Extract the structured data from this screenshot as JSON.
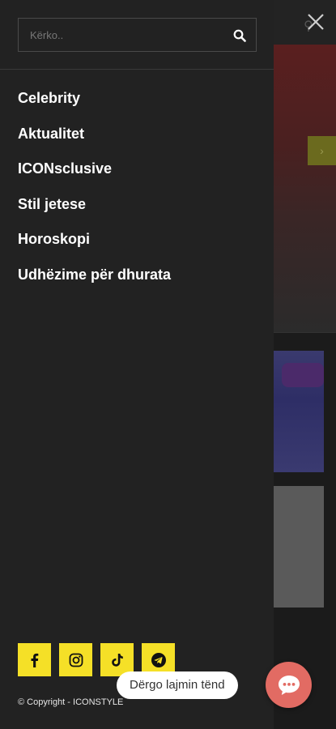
{
  "search": {
    "placeholder": "Kërko.."
  },
  "menu": {
    "items": [
      {
        "label": "Celebrity"
      },
      {
        "label": "Aktualitet"
      },
      {
        "label": "ICONsclusive"
      },
      {
        "label": "Stil jetese"
      },
      {
        "label": "Horoskopi"
      },
      {
        "label": "Udhëzime për dhurata"
      }
    ]
  },
  "socials": [
    {
      "icon": "facebook-icon"
    },
    {
      "icon": "instagram-icon"
    },
    {
      "icon": "tiktok-icon"
    },
    {
      "icon": "telegram-icon"
    }
  ],
  "footer": {
    "copyright": "© Copyright - ICONSTYLE"
  },
  "chat": {
    "label": "Dërgo lajmin tënd",
    "icon": "chat-bubble-icon"
  },
  "colors": {
    "drawer_bg": "#222222",
    "accent_yellow": "#f5e027",
    "chat_button": "#e26b63"
  }
}
